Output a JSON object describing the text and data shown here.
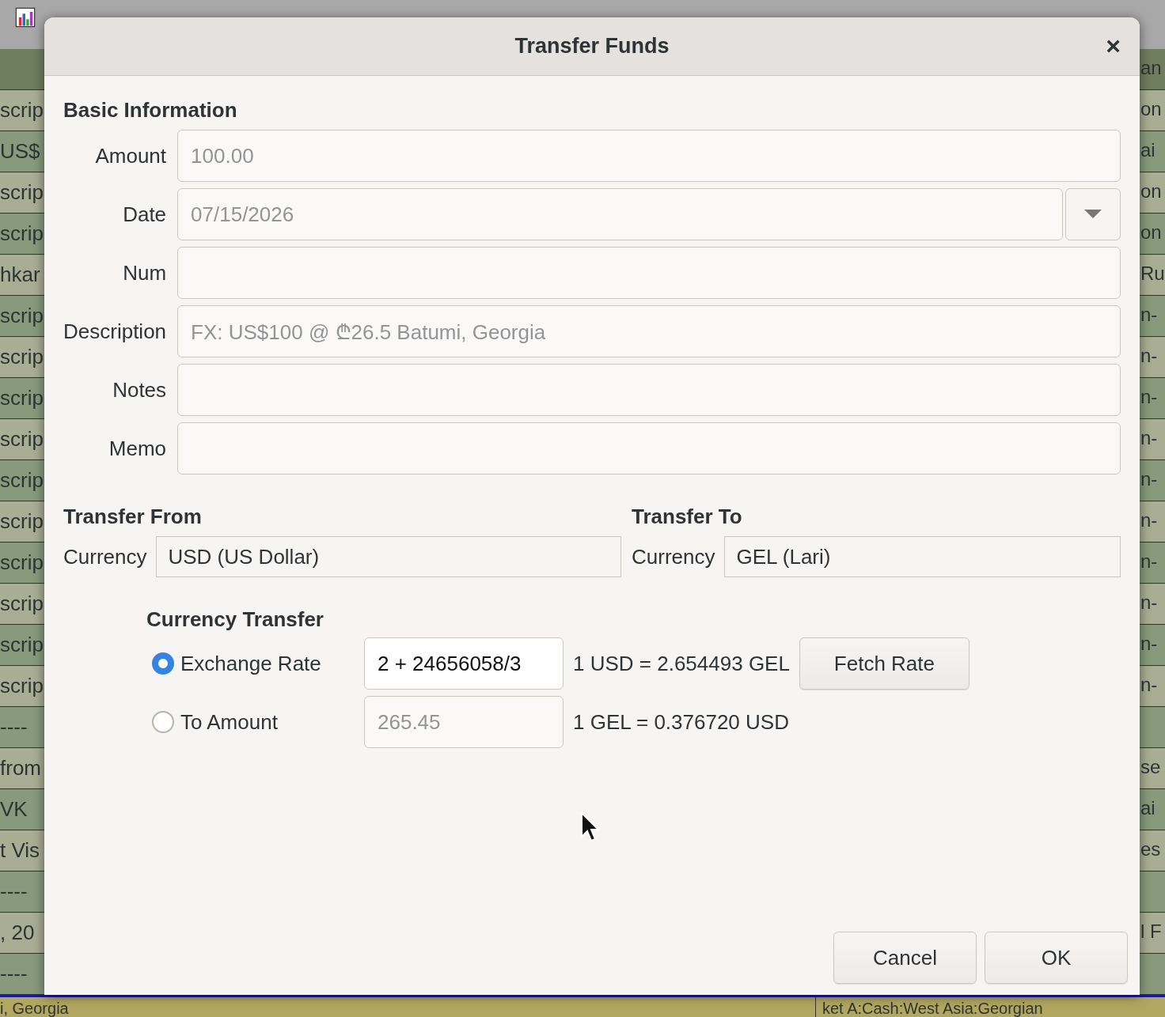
{
  "background": {
    "header": {
      "right": "an"
    },
    "rows": [
      {
        "left": "scrip",
        "right": "on"
      },
      {
        "left": "US$",
        "right": "ai"
      },
      {
        "left": "scrip",
        "right": "on"
      },
      {
        "left": "scrip",
        "right": "on"
      },
      {
        "left": "hkar",
        "right": "Ru"
      },
      {
        "left": "scrip",
        "right": "n-"
      },
      {
        "left": "scrip",
        "right": "n-"
      },
      {
        "left": "scrip",
        "right": "n-"
      },
      {
        "left": "scrip",
        "right": "n-"
      },
      {
        "left": "scrip",
        "right": "n-"
      },
      {
        "left": "scrip",
        "right": "n-"
      },
      {
        "left": "scrip",
        "right": "n-"
      },
      {
        "left": "scrip",
        "right": "n-"
      },
      {
        "left": "scrip",
        "right": "n-"
      },
      {
        "left": "scrip",
        "right": "n-"
      },
      {
        "left": "----"
      },
      {
        "left": "from",
        "right": "se"
      },
      {
        "left": "VK",
        "right": "ai"
      },
      {
        "left": "t Vis",
        "right": "es"
      },
      {
        "left": "----"
      },
      {
        "left": ", 20",
        "right": "l F"
      },
      {
        "left": "----"
      }
    ],
    "footer": {
      "left": "i, Georgia",
      "right": "ket A:Cash:West Asia:Georgian"
    }
  },
  "dialog": {
    "title": "Transfer Funds",
    "close": "×",
    "basic": {
      "heading": "Basic Information",
      "fields": [
        {
          "label": "Amount",
          "value": "100.00",
          "disabled": true,
          "kind": "entry"
        },
        {
          "label": "Date",
          "value": "07/15/2026",
          "disabled": true,
          "kind": "date"
        },
        {
          "label": "Num",
          "kind": "entry"
        },
        {
          "label": "Description",
          "value": "FX: US$100 @ ₾26.5 Batumi, Georgia",
          "disabled": true,
          "kind": "entry"
        },
        {
          "label": "Notes",
          "kind": "entry"
        },
        {
          "label": "Memo",
          "kind": "entry"
        }
      ]
    },
    "transfer_from": {
      "heading": "Transfer From",
      "label": "Currency",
      "value": "USD (US Dollar)"
    },
    "transfer_to": {
      "heading": "Transfer To",
      "label": "Currency",
      "value": "GEL (Lari)"
    },
    "currency_transfer": {
      "heading": "Currency Transfer",
      "options": [
        {
          "label": "Exchange Rate",
          "selected": true,
          "value": "2 + 24656058/3",
          "disabled": false,
          "reading": "1 USD = 2.654493 GEL",
          "button": "Fetch Rate"
        },
        {
          "label": "To Amount",
          "selected": false,
          "value": "265.45",
          "disabled": true,
          "reading": "1 GEL = 0.376720 USD"
        }
      ]
    },
    "buttons": [
      "Cancel",
      "OK"
    ]
  }
}
